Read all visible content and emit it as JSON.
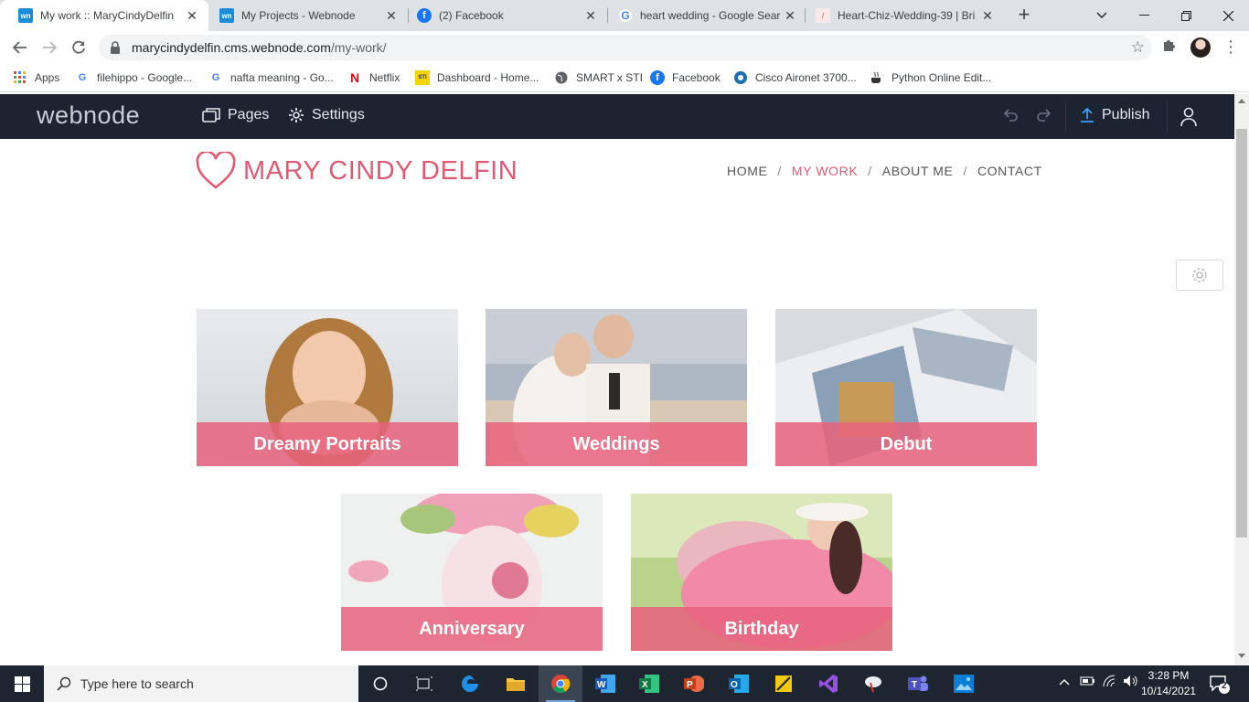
{
  "browser": {
    "tabs": [
      {
        "title": "My work :: MaryCindyDelfin",
        "favicon": "wn",
        "color": "#1a8cd8"
      },
      {
        "title": "My Projects - Webnode",
        "favicon": "wn",
        "color": "#1a8cd8"
      },
      {
        "title": "(2) Facebook",
        "favicon": "f",
        "color": "#1877f2"
      },
      {
        "title": "heart wedding - Google Sear",
        "favicon": "G",
        "color": "#4285f4"
      },
      {
        "title": "Heart-Chiz-Wedding-39 | Bri",
        "favicon": "/",
        "color": "#c77"
      }
    ],
    "address": {
      "host": "marycindydelfin.cms.webnode.com",
      "path": "/my-work/"
    },
    "bookmarks": [
      {
        "label": "Apps",
        "icon": "apps-grid-icon"
      },
      {
        "label": "filehippo - Google...",
        "icon": "G"
      },
      {
        "label": "nafta meaning - Go...",
        "icon": "G"
      },
      {
        "label": "Netflix",
        "icon": "N"
      },
      {
        "label": "Dashboard - Home...",
        "icon": "STI"
      },
      {
        "label": "SMART x STI",
        "icon": "globe-icon"
      },
      {
        "label": "Facebook",
        "icon": "f"
      },
      {
        "label": "Cisco Aironet 3700...",
        "icon": "cisco-icon"
      },
      {
        "label": "Python Online Edit...",
        "icon": "coffee-icon"
      }
    ]
  },
  "editor": {
    "logo": "webnode",
    "pages_label": "Pages",
    "settings_label": "Settings",
    "publish_label": "Publish"
  },
  "site": {
    "brand": "MARY CINDY DELFIN",
    "nav": [
      "HOME",
      "MY WORK",
      "ABOUT ME",
      "CONTACT"
    ],
    "nav_active": "MY WORK",
    "accent": "#e05a74",
    "cards": [
      {
        "caption": "Dreamy Portraits"
      },
      {
        "caption": "Weddings"
      },
      {
        "caption": "Debut"
      },
      {
        "caption": "Anniversary"
      },
      {
        "caption": "Birthday"
      }
    ]
  },
  "taskbar": {
    "search_placeholder": "Type here to search",
    "time": "3:28 PM",
    "date": "10/14/2021",
    "notifications": "2"
  }
}
